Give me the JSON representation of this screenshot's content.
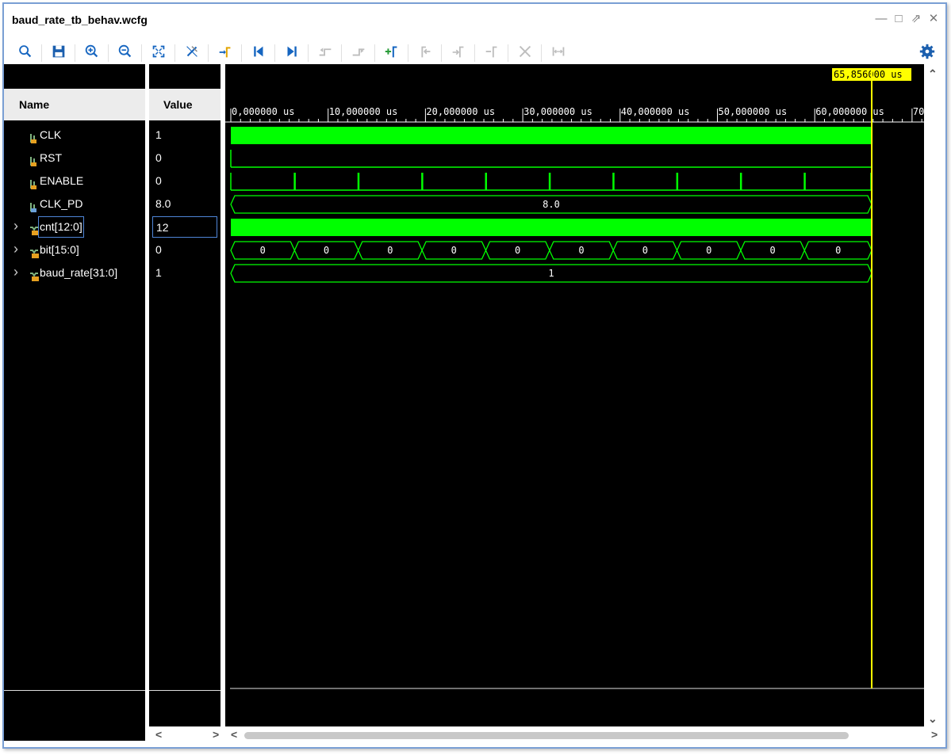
{
  "window": {
    "title": "baud_rate_tb_behav.wcfg",
    "controls": [
      "minimize-icon",
      "maximize-icon",
      "restore-icon",
      "close-icon"
    ]
  },
  "toolbar": [
    {
      "name": "search-button",
      "icon": "search-icon",
      "enabled": true
    },
    {
      "name": "save-button",
      "icon": "save-icon",
      "enabled": true
    },
    {
      "name": "zoom-in-button",
      "icon": "zoom-in-icon",
      "enabled": true
    },
    {
      "name": "zoom-out-button",
      "icon": "zoom-out-icon",
      "enabled": true
    },
    {
      "name": "zoom-fit-button",
      "icon": "zoom-fit-icon",
      "enabled": true
    },
    {
      "name": "snap-button",
      "icon": "snap-icon",
      "enabled": true
    },
    {
      "name": "go-to-cursor-button",
      "icon": "go-to-cursor-icon",
      "enabled": true
    },
    {
      "name": "go-to-start-button",
      "icon": "go-to-start-icon",
      "enabled": true
    },
    {
      "name": "go-to-end-button",
      "icon": "go-to-end-icon",
      "enabled": true
    },
    {
      "name": "previous-transition-button",
      "icon": "previous-transition-icon",
      "enabled": false
    },
    {
      "name": "next-transition-button",
      "icon": "next-transition-icon",
      "enabled": false
    },
    {
      "name": "add-marker-button",
      "icon": "add-marker-icon",
      "enabled": true
    },
    {
      "name": "previous-marker-button",
      "icon": "previous-marker-icon",
      "enabled": false
    },
    {
      "name": "next-marker-button",
      "icon": "next-marker-icon",
      "enabled": false
    },
    {
      "name": "delete-marker-button",
      "icon": "delete-marker-icon",
      "enabled": false
    },
    {
      "name": "delete-all-markers-button",
      "icon": "delete-all-markers-icon",
      "enabled": false
    },
    {
      "name": "swap-cursors-button",
      "icon": "swap-cursors-icon",
      "enabled": false
    },
    {
      "name": "settings-button",
      "icon": "gear-icon",
      "enabled": true
    }
  ],
  "columns": {
    "name": "Name",
    "value": "Value"
  },
  "signals": [
    {
      "name": "CLK",
      "value": "1",
      "kind": "scalar",
      "expandable": false
    },
    {
      "name": "RST",
      "value": "0",
      "kind": "scalar",
      "expandable": false
    },
    {
      "name": "ENABLE",
      "value": "0",
      "kind": "scalar",
      "expandable": false
    },
    {
      "name": "CLK_PD",
      "value": "8.0",
      "kind": "real",
      "expandable": false
    },
    {
      "name": "cnt[12:0]",
      "value": "12",
      "kind": "bus",
      "expandable": true,
      "selected": true
    },
    {
      "name": "bit[15:0]",
      "value": "0",
      "kind": "bus",
      "expandable": true
    },
    {
      "name": "baud_rate[31:0]",
      "value": "1",
      "kind": "bus",
      "expandable": true
    }
  ],
  "timeline": {
    "unit": "us",
    "tick_labels": [
      "0,000000 us",
      "10,000000 us",
      "20,000000 us",
      "30,000000 us",
      "40,000000 us",
      "50,000000 us",
      "60,000000 us",
      "70"
    ],
    "cursor_label": "65,856000 us",
    "cursor_time": 65.856,
    "view_start": 0,
    "view_end": 71.3
  },
  "waves": {
    "enable_pulses_us": [
      6.55,
      13.1,
      19.65,
      26.2,
      32.75,
      39.3,
      45.85,
      52.4,
      58.95
    ],
    "clk_pd_label": "8.0",
    "bit_segments": [
      {
        "start": 0,
        "end": 6.55,
        "label": "0"
      },
      {
        "start": 6.55,
        "end": 13.1,
        "label": "0"
      },
      {
        "start": 13.1,
        "end": 19.65,
        "label": "0"
      },
      {
        "start": 19.65,
        "end": 26.2,
        "label": "0"
      },
      {
        "start": 26.2,
        "end": 32.75,
        "label": "0"
      },
      {
        "start": 32.75,
        "end": 39.3,
        "label": "0"
      },
      {
        "start": 39.3,
        "end": 45.85,
        "label": "0"
      },
      {
        "start": 45.85,
        "end": 52.4,
        "label": "0"
      },
      {
        "start": 52.4,
        "end": 58.95,
        "label": "0"
      },
      {
        "start": 58.95,
        "end": 65.856,
        "label": "0"
      }
    ],
    "baud_rate_label": "1"
  },
  "colors": {
    "wave": "#00ff00",
    "cursor": "#ffff00",
    "background": "#000000",
    "accent": "#1565c0"
  }
}
